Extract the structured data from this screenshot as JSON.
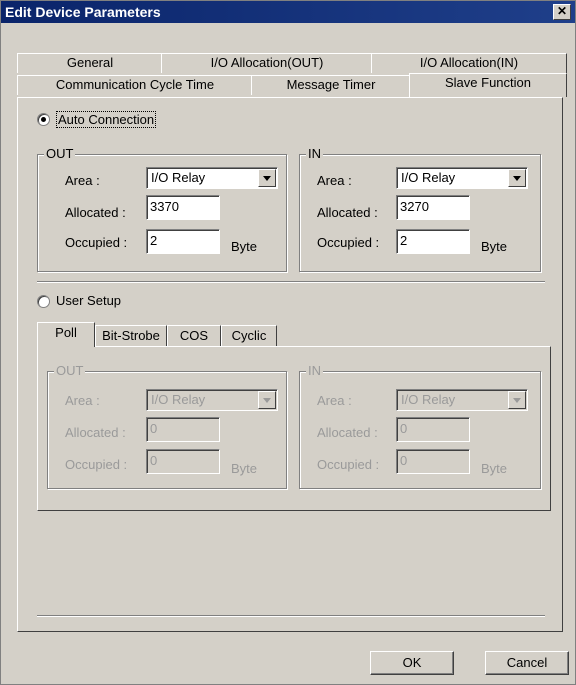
{
  "window": {
    "title": "Edit Device Parameters",
    "close_glyph": "✕"
  },
  "tabs_row1": [
    {
      "label": "General"
    },
    {
      "label": "I/O Allocation(OUT)"
    },
    {
      "label": "I/O Allocation(IN)"
    }
  ],
  "tabs_row2": [
    {
      "label": "Communication Cycle Time"
    },
    {
      "label": "Message Timer"
    },
    {
      "label": "Slave Function",
      "active": true
    }
  ],
  "auto": {
    "label": "Auto Connection",
    "selected": true,
    "out": {
      "title": "OUT",
      "area_label": "Area :",
      "area_value": "I/O Relay",
      "allocated_label": "Allocated :",
      "allocated_value": "3370",
      "occupied_label": "Occupied :",
      "occupied_value": "2",
      "unit": "Byte"
    },
    "in": {
      "title": "IN",
      "area_label": "Area :",
      "area_value": "I/O Relay",
      "allocated_label": "Allocated :",
      "allocated_value": "3270",
      "occupied_label": "Occupied :",
      "occupied_value": "2",
      "unit": "Byte"
    }
  },
  "user": {
    "label": "User Setup",
    "selected": false,
    "subtabs": [
      {
        "label": "Poll",
        "active": true
      },
      {
        "label": "Bit-Strobe"
      },
      {
        "label": "COS"
      },
      {
        "label": "Cyclic"
      }
    ],
    "out": {
      "title": "OUT",
      "area_label": "Area :",
      "area_value": "I/O Relay",
      "allocated_label": "Allocated :",
      "allocated_value": "0",
      "occupied_label": "Occupied :",
      "occupied_value": "0",
      "unit": "Byte"
    },
    "in": {
      "title": "IN",
      "area_label": "Area :",
      "area_value": "I/O Relay",
      "allocated_label": "Allocated :",
      "allocated_value": "0",
      "occupied_label": "Occupied :",
      "occupied_value": "0",
      "unit": "Byte"
    }
  },
  "buttons": {
    "ok": "OK",
    "cancel": "Cancel"
  }
}
